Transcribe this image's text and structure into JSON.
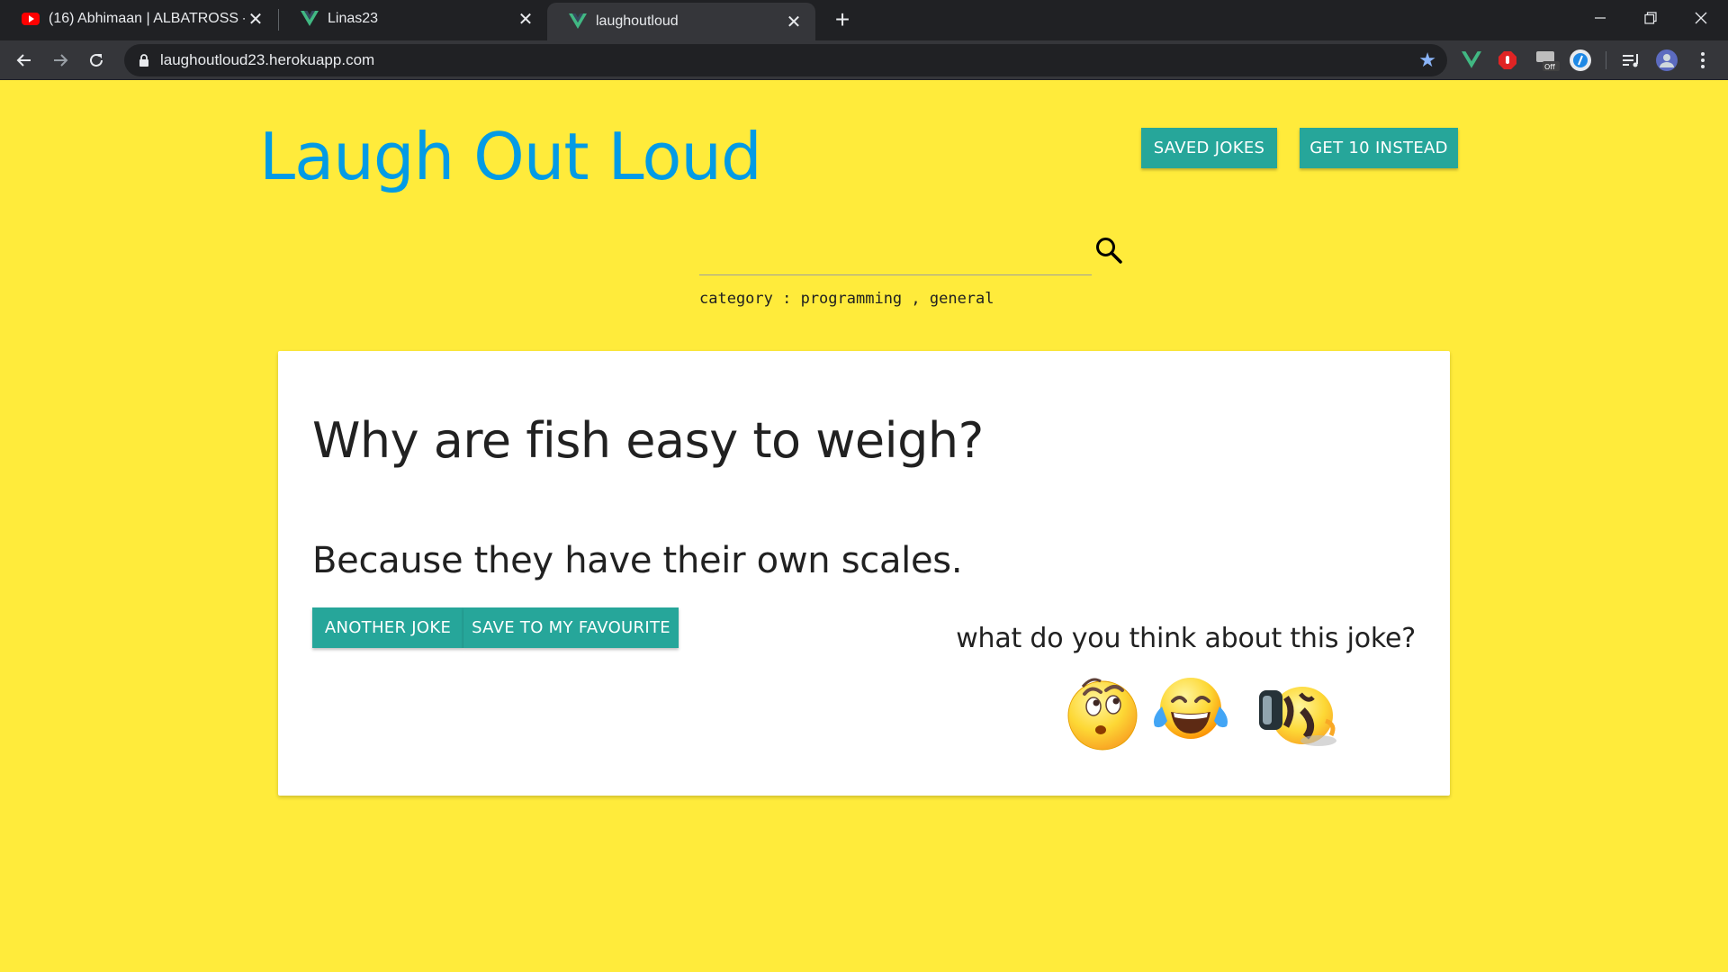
{
  "browser": {
    "tabs": [
      {
        "title": "(16) Abhimaan | ALBATROSS - Yo",
        "favicon": "youtube-icon"
      },
      {
        "title": "Linas23",
        "favicon": "vue-icon"
      },
      {
        "title": "laughoutloud",
        "favicon": "vue-icon",
        "active": true
      }
    ],
    "url": "laughoutloud23.herokuapp.com",
    "extensions": [
      "vue-devtools-icon",
      "adblock-icon",
      "cache-killer-icon",
      "ext-circle-icon",
      "media-icon",
      "profile-avatar"
    ]
  },
  "page": {
    "title": "Laugh Out Loud",
    "header_buttons": {
      "saved_jokes": "SAVED JOKES",
      "get_ten": "GET 10 INSTEAD"
    },
    "search": {
      "value": "",
      "placeholder": ""
    },
    "category_line": "category : programming , general",
    "joke": {
      "question": "Why are fish easy to weigh?",
      "answer": "Because they have their own scales."
    },
    "joke_buttons": {
      "another": "ANOTHER JOKE",
      "save": "SAVE TO MY FAVOURITE"
    },
    "rating": {
      "prompt": "what do you think about this joke?",
      "options": [
        "thinking-emoji",
        "tears-of-joy-emoji",
        "rolling-laughing-emoji"
      ]
    }
  },
  "colors": {
    "background": "#ffeb3b",
    "title": "#039be5",
    "button": "#26a69a"
  }
}
